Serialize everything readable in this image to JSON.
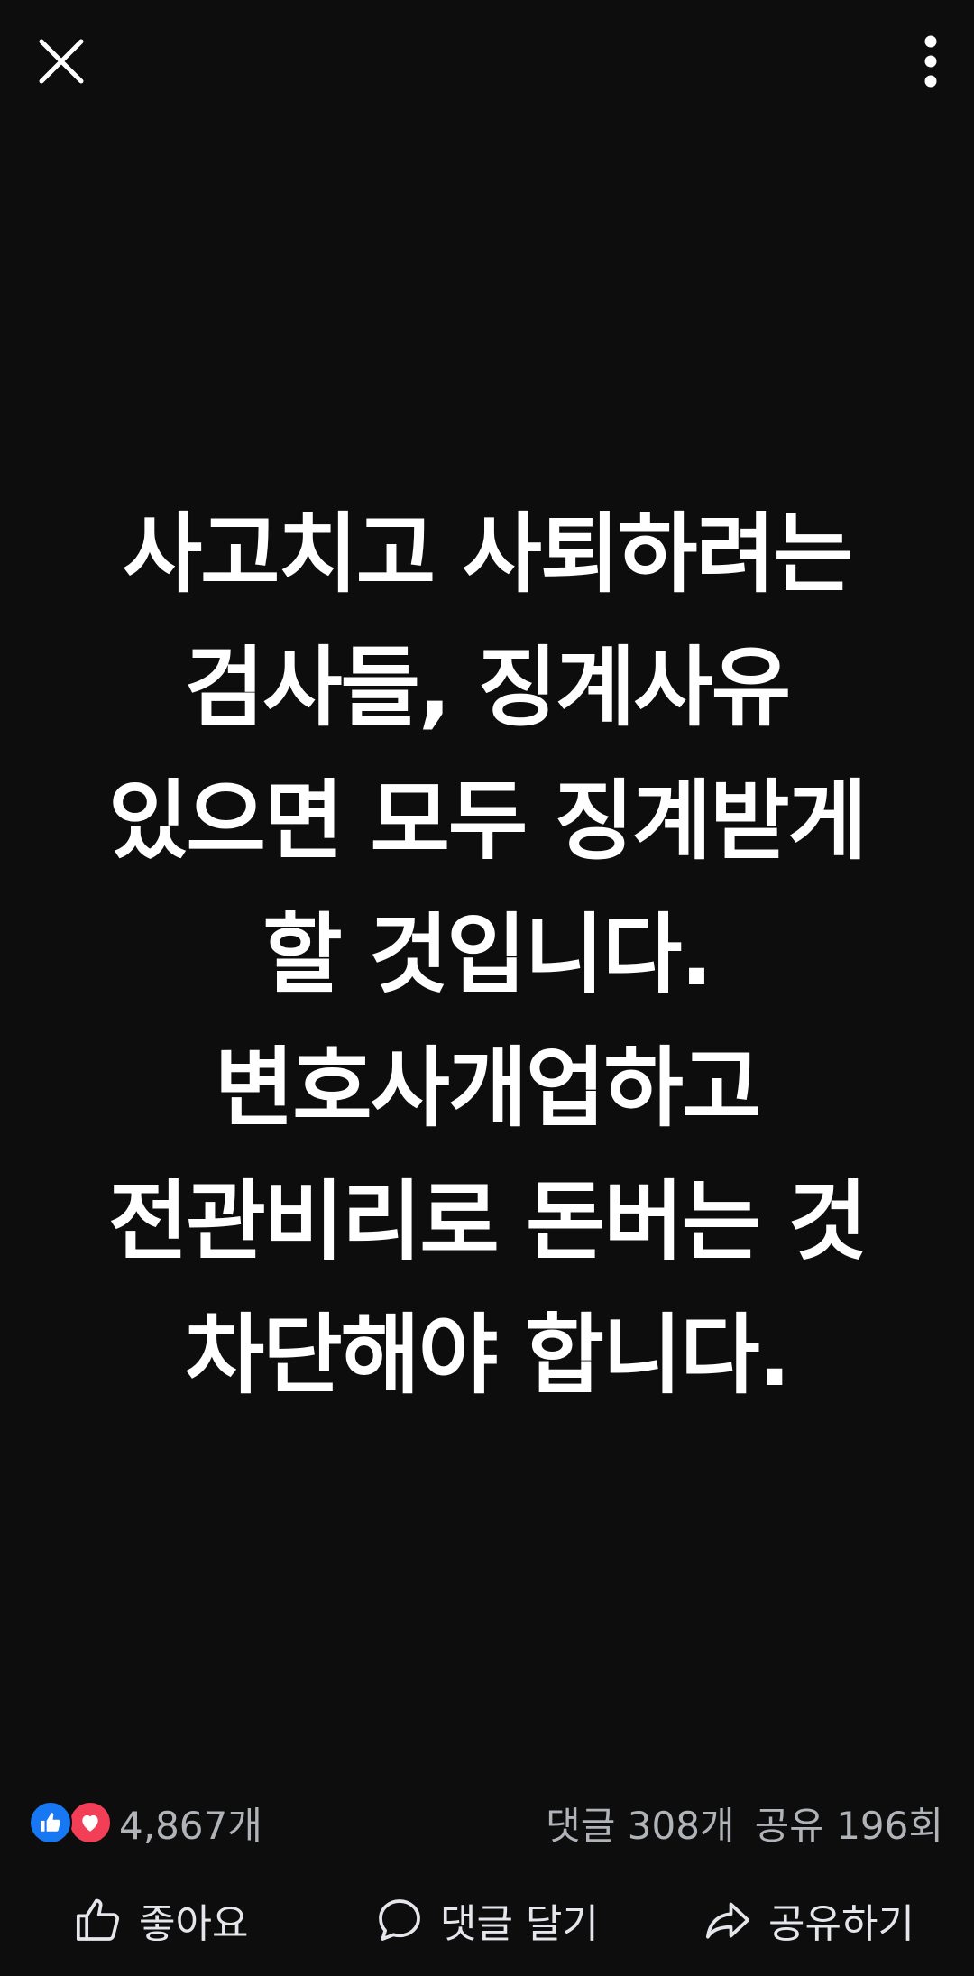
{
  "post": {
    "lines": [
      "사고치고 사퇴하려는",
      "검사들, 징계사유",
      "있으면 모두 징계받게",
      "할 것입니다.",
      "변호사개업하고",
      "전관비리로 돈버는 것",
      "차단해야 합니다."
    ]
  },
  "top_bar": {
    "close_icon": "close-icon",
    "more_icon": "more-vertical-icon"
  },
  "stats": {
    "reaction_count": "4,867개",
    "comments": "댓글 308개",
    "shares": "공유 196회",
    "reaction_icons": [
      "like-icon",
      "love-icon"
    ],
    "colors": {
      "like": "#1877f2",
      "love": "#f33e58"
    }
  },
  "actions": {
    "like_label": "좋아요",
    "comment_label": "댓글 달기",
    "share_label": "공유하기"
  }
}
